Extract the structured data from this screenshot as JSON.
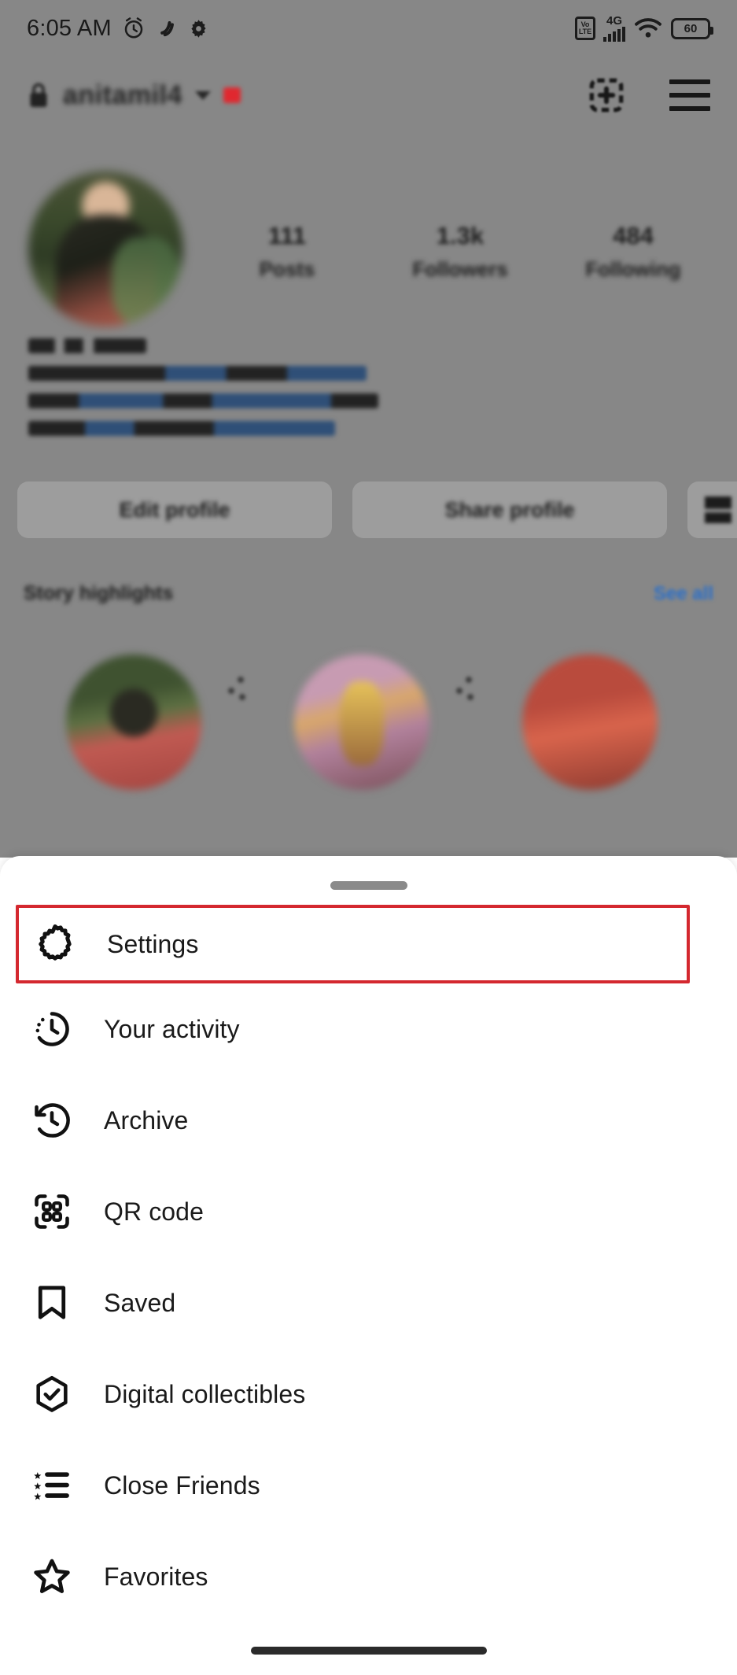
{
  "status_bar": {
    "time": "6:05 AM",
    "icons_left": [
      "alarm-icon",
      "data-saver-icon",
      "gear-icon"
    ],
    "network_label": "VoLTE",
    "network_type": "4G",
    "battery_percent": "60",
    "icons_right": [
      "volte-icon",
      "signal-icon",
      "wifi-icon",
      "battery-icon"
    ]
  },
  "profile": {
    "username": "anitamil4",
    "username_blurred": true,
    "verified_badge": "red-badge",
    "dropdown_icon": "chevron-down-icon",
    "new_post_icon": "add-post-icon",
    "menu_icon": "hamburger-menu-icon",
    "avatar_alt": "profile-photo",
    "stats": [
      {
        "count": "111",
        "label": "Posts"
      },
      {
        "count": "1.3k",
        "label": "Followers"
      },
      {
        "count": "484",
        "label": "Following"
      }
    ],
    "bio_lines": [
      "",
      "",
      "",
      ""
    ],
    "buttons": [
      {
        "label": "Edit profile",
        "kind": "wide"
      },
      {
        "label": "Share profile",
        "kind": "wide"
      },
      {
        "label": "",
        "kind": "small",
        "icon": "add-person-icon"
      }
    ],
    "highlights": {
      "title": "Story highlights",
      "see_all": "See all",
      "items": [
        {
          "name": "highlight-1"
        },
        {
          "name": "highlight-2"
        },
        {
          "name": "highlight-3"
        }
      ]
    }
  },
  "sheet": {
    "handle": "drag-handle",
    "menu_items": [
      {
        "label": "Settings",
        "icon": "gear-icon",
        "highlighted": true
      },
      {
        "label": "Your activity",
        "icon": "activity-clock-icon",
        "highlighted": false
      },
      {
        "label": "Archive",
        "icon": "archive-clock-icon",
        "highlighted": false
      },
      {
        "label": "QR code",
        "icon": "qr-code-icon",
        "highlighted": false
      },
      {
        "label": "Saved",
        "icon": "bookmark-icon",
        "highlighted": false
      },
      {
        "label": "Digital collectibles",
        "icon": "hexagon-check-icon",
        "highlighted": false
      },
      {
        "label": "Close Friends",
        "icon": "star-list-icon",
        "highlighted": false
      },
      {
        "label": "Favorites",
        "icon": "star-icon",
        "highlighted": false
      }
    ]
  },
  "colors": {
    "highlight_red": "#d4282f",
    "link_blue": "#2a6fc9",
    "backdrop_gray": "#878787",
    "sheet_white": "#ffffff",
    "text_primary": "#1a1a1a"
  }
}
